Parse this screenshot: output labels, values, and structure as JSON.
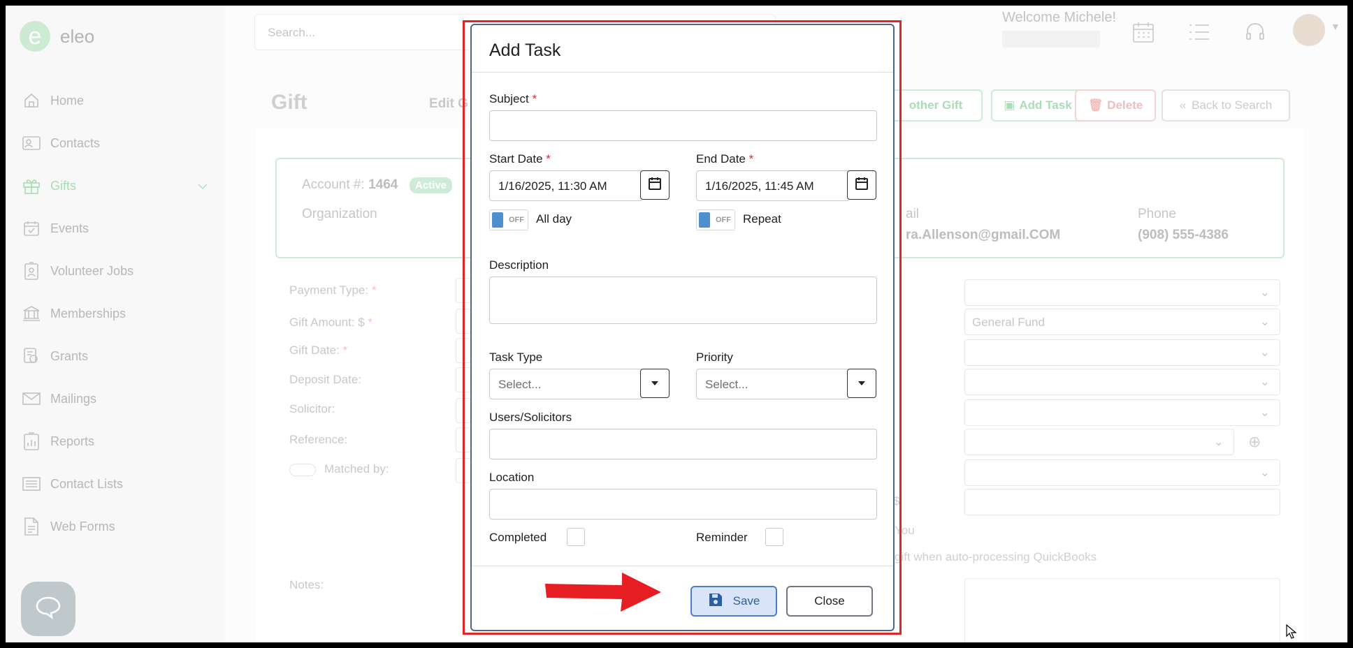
{
  "sidebar": {
    "logo_text": "eleo",
    "items": [
      {
        "label": "Home",
        "icon": "home-icon"
      },
      {
        "label": "Contacts",
        "icon": "contact-card-icon"
      },
      {
        "label": "Gifts",
        "icon": "gift-icon"
      },
      {
        "label": "Events",
        "icon": "calendar-check-icon"
      },
      {
        "label": "Volunteer Jobs",
        "icon": "badge-icon"
      },
      {
        "label": "Memberships",
        "icon": "bank-icon"
      },
      {
        "label": "Grants",
        "icon": "grant-icon"
      },
      {
        "label": "Mailings",
        "icon": "mail-icon"
      },
      {
        "label": "Reports",
        "icon": "report-icon"
      },
      {
        "label": "Contact Lists",
        "icon": "list-icon"
      },
      {
        "label": "Web Forms",
        "icon": "form-icon"
      }
    ]
  },
  "topbar": {
    "search_placeholder": "Search...",
    "welcome": "Welcome Michele!"
  },
  "page": {
    "title": "Gift",
    "edit_tab": "Edit G",
    "buttons": {
      "another_gift": "other Gift",
      "add_task": "Add Task",
      "delete": "Delete",
      "back": "Back to Search"
    },
    "account": {
      "label": "Account #:",
      "number": "1464",
      "status": "Active",
      "organization_label": "Organization",
      "email_label": "ail",
      "email": "ra.Allenson@gmail.COM",
      "phone_label": "Phone",
      "phone": "(908) 555-4386"
    },
    "fields": {
      "payment_type": "Payment Type:",
      "gift_amount": "Gift Amount: $",
      "gift_date": "Gift Date:",
      "deposit_date": "Deposit Date:",
      "solicitor": "Solicitor:",
      "reference": "Reference:",
      "matched_by": "Matched by:",
      "notes": "Notes:",
      "required_mark": "*"
    },
    "right_fund": "General Fund",
    "right_text_1": "You",
    "right_text_2": "gift when auto-processing QuickBooks",
    "right_dollar": "$"
  },
  "modal": {
    "title": "Add Task",
    "subject_label": "Subject",
    "subject_value": "",
    "required_mark": "*",
    "start_date_label": "Start Date",
    "start_date_value": "1/16/2025, 11:30 AM",
    "end_date_label": "End Date",
    "end_date_value": "1/16/2025, 11:45 AM",
    "toggle_off": "OFF",
    "all_day_label": "All day",
    "repeat_label": "Repeat",
    "description_label": "Description",
    "task_type_label": "Task Type",
    "task_type_value": "Select...",
    "priority_label": "Priority",
    "priority_value": "Select...",
    "users_label": "Users/Solicitors",
    "location_label": "Location",
    "completed_label": "Completed",
    "reminder_label": "Reminder",
    "save_label": "Save",
    "close_label": "Close"
  },
  "colors": {
    "highlight": "#e0262b",
    "arrow": "#e61e24",
    "save_bg": "#d9e4f8",
    "save_border": "#4a7fc4",
    "toggle_knob": "#4e8fce"
  }
}
